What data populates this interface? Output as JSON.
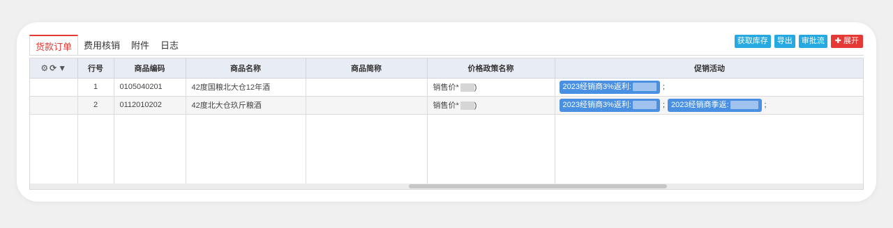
{
  "tabs": [
    {
      "label": "货款订单",
      "active": true
    },
    {
      "label": "费用核销",
      "active": false
    },
    {
      "label": "附件",
      "active": false
    },
    {
      "label": "日志",
      "active": false
    }
  ],
  "actions": {
    "get_stock": "获取库存",
    "export": "导出",
    "approval_flow": "审批流",
    "expand_icon": "plus-icon",
    "expand": "展开"
  },
  "colors": {
    "accent_red": "#e53935",
    "action_blue": "#26a9e0",
    "chip_blue": "#4a90e2",
    "header_bg": "#e8ecf4"
  },
  "table": {
    "header_icons": [
      "gear-icon",
      "refresh-icon",
      "filter-icon"
    ],
    "columns": [
      "行号",
      "商品编码",
      "商品名称",
      "商品简称",
      "价格政策名称",
      "促销活动"
    ],
    "rows": [
      {
        "line_no": "1",
        "code": "0105040201",
        "name": "42度国粮北大仓12年酒",
        "short_name": "",
        "price_policy_prefix": "销售价*",
        "price_policy_suffix": ")",
        "promotions": [
          {
            "label": "2023经销商3%返利:"
          }
        ],
        "promo_sep": ";"
      },
      {
        "line_no": "2",
        "code": "0112010202",
        "name": "42度北大仓玖斤粮酒",
        "short_name": "",
        "price_policy_prefix": "销售价*",
        "price_policy_suffix": ")",
        "promotions": [
          {
            "label": "2023经销商3%返利:"
          },
          {
            "label": "2023经销商季返:"
          }
        ],
        "promo_sep": ";"
      }
    ]
  }
}
